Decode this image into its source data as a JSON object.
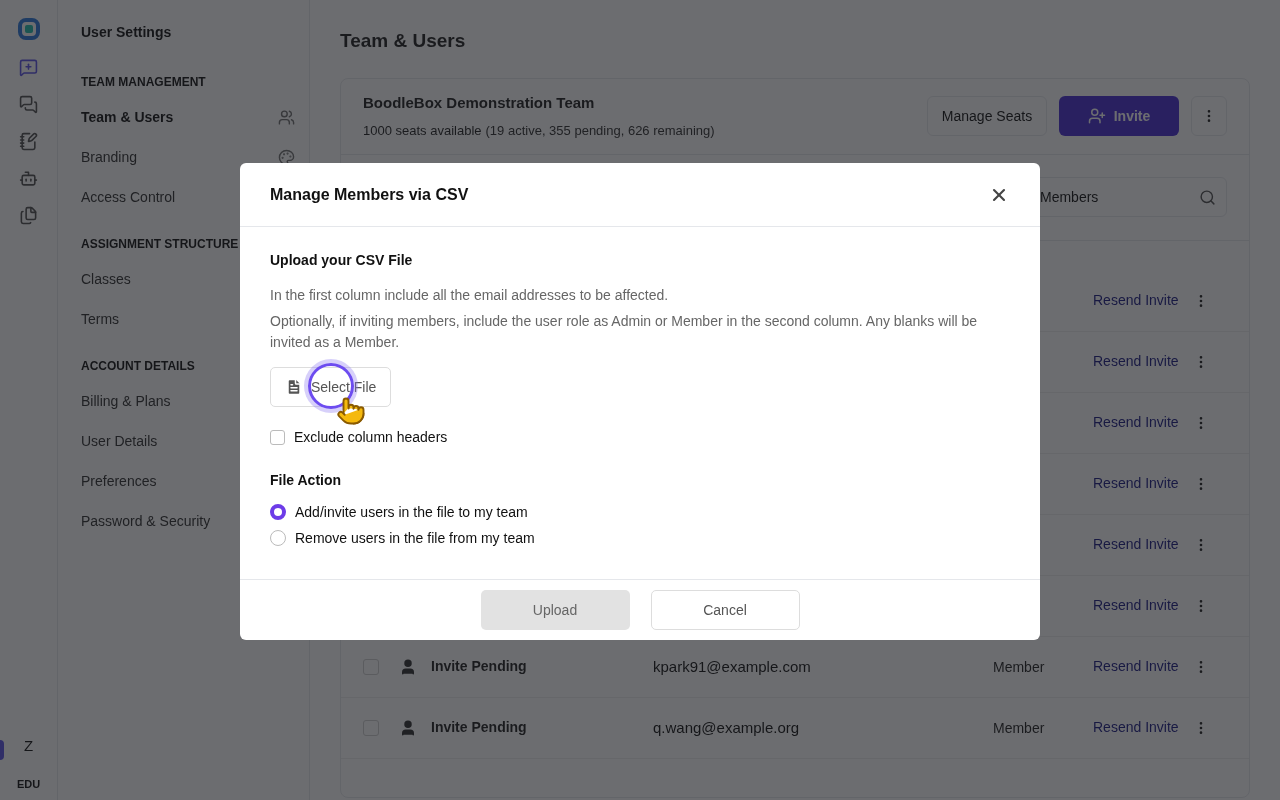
{
  "rail": {
    "avatar": "Z",
    "plan": "EDU"
  },
  "settings_nav": {
    "title": "User Settings",
    "sections": [
      {
        "heading": "TEAM MANAGEMENT",
        "items": [
          {
            "label": "Team & Users",
            "selected": true
          },
          {
            "label": "Branding",
            "selected": false
          },
          {
            "label": "Access Control",
            "selected": false
          }
        ]
      },
      {
        "heading": "ASSIGNMENT STRUCTURE",
        "items": [
          {
            "label": "Classes",
            "selected": false
          },
          {
            "label": "Terms",
            "selected": false
          }
        ]
      },
      {
        "heading": "ACCOUNT DETAILS",
        "items": [
          {
            "label": "Billing & Plans",
            "selected": false
          },
          {
            "label": "User Details",
            "selected": false
          },
          {
            "label": "Preferences",
            "selected": false
          },
          {
            "label": "Password & Security",
            "selected": false
          }
        ]
      }
    ]
  },
  "page_title": "Team & Users",
  "team": {
    "name": "BoodleBox Demonstration Team",
    "seats": "1000 seats available",
    "seat_detail": "(19 active, 355 pending, 626 remaining)",
    "buttons": [
      {
        "label": "Manage Seats",
        "kind": "secondary"
      },
      {
        "label": "Invite",
        "kind": "primary"
      }
    ]
  },
  "search": {
    "placeholder": "Members"
  },
  "rows": [
    {
      "action": "Resend Invite"
    },
    {
      "action": "Resend Invite"
    },
    {
      "action": "Resend Invite"
    },
    {
      "action": "Resend Invite"
    },
    {
      "action": "Resend Invite"
    },
    {
      "action": "Resend Invite"
    },
    {
      "name": "Invite Pending",
      "email": "kpark91@example.com",
      "role": "Member",
      "action": "Resend Invite",
      "checked": false
    },
    {
      "name": "Invite Pending",
      "email": "q.wang@example.org",
      "role": "Member",
      "action": "Resend Invite",
      "checked": false
    }
  ],
  "dialog": {
    "title": "Manage Members via CSV",
    "section_title": "Upload your CSV File",
    "paragraphs": [
      "In the first column include all the email addresses to be affected.",
      "Optionally, if inviting members, include the user role as Admin or Member in the second column. Any blanks will be invited as a Member."
    ],
    "file_button": "Select File",
    "exclude_headers": {
      "label": "Exclude column headers",
      "checked": false
    },
    "file_action": {
      "title": "File Action",
      "options": [
        {
          "label": "Add/invite users in the file to my team",
          "selected": true
        },
        {
          "label": "Remove users in the file from my team",
          "selected": false
        }
      ]
    },
    "buttons": [
      {
        "label": "Upload",
        "kind": "primary",
        "disabled": true
      },
      {
        "label": "Cancel",
        "kind": "secondary",
        "disabled": false
      }
    ]
  }
}
